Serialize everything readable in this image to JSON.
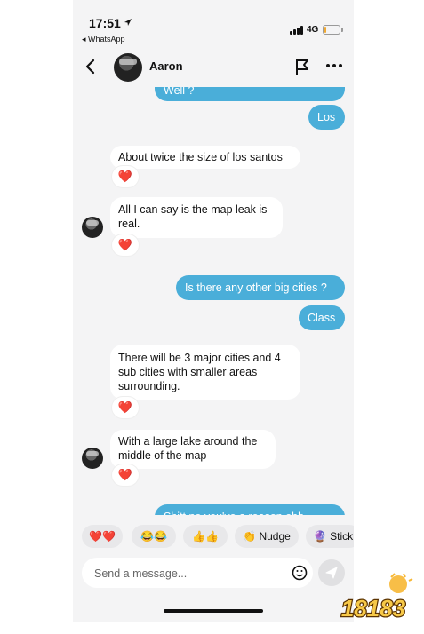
{
  "status_bar": {
    "time": "17:51",
    "back_app": "◂ WhatsApp",
    "network": "4G"
  },
  "header": {
    "contact_name": "Aaron"
  },
  "messages": [
    {
      "dir": "out",
      "text": "Well ?"
    },
    {
      "dir": "out",
      "text": "Los"
    },
    {
      "dir": "in",
      "text": "About twice the size of los santos",
      "reaction": "❤️"
    },
    {
      "dir": "in",
      "text": "All I can say is the map leak is real.",
      "reaction": "❤️"
    },
    {
      "dir": "out",
      "text": "Is there any other big cities ?"
    },
    {
      "dir": "out",
      "text": "Class"
    },
    {
      "dir": "in",
      "text": "There will be 3 major cities and 4 sub cities with smaller areas surrounding.",
      "reaction": "❤️"
    },
    {
      "dir": "in",
      "text": "With a large lake around the middle of the map",
      "reaction": "❤️"
    },
    {
      "dir": "out",
      "text": "Shitt no you've a reason ebb..."
    }
  ],
  "quick_replies": [
    "❤️❤️",
    "😂😂",
    "👍👍",
    "👏 Nudge",
    "🔮 Stick"
  ],
  "composer": {
    "placeholder": "Send a message..."
  },
  "watermark": {
    "text": "18183"
  },
  "colors": {
    "outgoing_bubble": "#4aaed9",
    "incoming_bubble": "#ffffff",
    "background": "#f4f4f5"
  }
}
